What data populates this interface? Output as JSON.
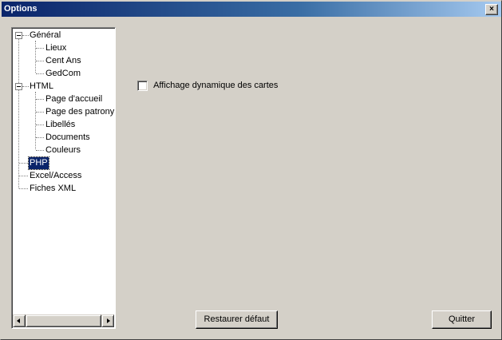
{
  "window": {
    "title": "Options",
    "close_label": "×"
  },
  "tree": {
    "groups": [
      {
        "label": "Général",
        "expanded": true,
        "children": [
          "Lieux",
          "Cent Ans",
          "GedCom"
        ]
      },
      {
        "label": "HTML",
        "expanded": true,
        "children": [
          "Page d'accueil",
          "Page des patronymes",
          "Libellés",
          "Documents",
          "Couleurs"
        ]
      }
    ],
    "leaves": [
      "PHP",
      "Excel/Access",
      "Fiches XML"
    ],
    "selected": "PHP"
  },
  "panel": {
    "checkbox_label": "Affichage dynamique des cartes",
    "checkbox_checked": false
  },
  "buttons": {
    "restore": "Restaurer défaut",
    "quit": "Quitter"
  },
  "colors": {
    "titlebar_start": "#0a246a",
    "titlebar_end": "#a6caf0",
    "face": "#d4d0c8",
    "selection": "#0a246a"
  }
}
